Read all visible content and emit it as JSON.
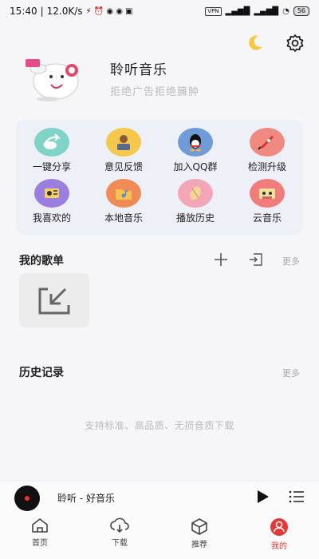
{
  "status_bar": {
    "time": "15:40",
    "speed": "12.0K/s",
    "vpn": "VPN",
    "battery": "56"
  },
  "header": {
    "theme_icon": "moon-icon",
    "settings_icon": "gear-icon"
  },
  "profile": {
    "name": "聆听音乐",
    "subtitle": "拒绝广告拒绝臃肿"
  },
  "features": [
    {
      "label": "一键分享",
      "icon": "share-icon",
      "color": "#7fd3c7"
    },
    {
      "label": "意见反馈",
      "icon": "feedback-icon",
      "color": "#f5c84c"
    },
    {
      "label": "加入QQ群",
      "icon": "qq-icon",
      "color": "#6f9bd8"
    },
    {
      "label": "检测升级",
      "icon": "rocket-icon",
      "color": "#f08a80"
    },
    {
      "label": "我喜欢的",
      "icon": "favorite-icon",
      "color": "#9a7fe0"
    },
    {
      "label": "本地音乐",
      "icon": "folder-music-icon",
      "color": "#f08b55"
    },
    {
      "label": "播放历史",
      "icon": "history-icon",
      "color": "#f2a6b8"
    },
    {
      "label": "云音乐",
      "icon": "cassette-icon",
      "color": "#f07c7c"
    }
  ],
  "playlists": {
    "title": "我的歌单",
    "more": "更多"
  },
  "history": {
    "title": "历史记录",
    "more": "更多",
    "empty_text": "支持标准、高品质、无损音质下载"
  },
  "player": {
    "title": "聆听 - 好音乐"
  },
  "tabs": [
    {
      "label": "首页",
      "icon": "home-icon"
    },
    {
      "label": "下载",
      "icon": "download-icon"
    },
    {
      "label": "推荐",
      "icon": "cube-icon"
    },
    {
      "label": "我的",
      "icon": "user-icon",
      "active": true
    }
  ],
  "accent_color": "#e23a3a"
}
